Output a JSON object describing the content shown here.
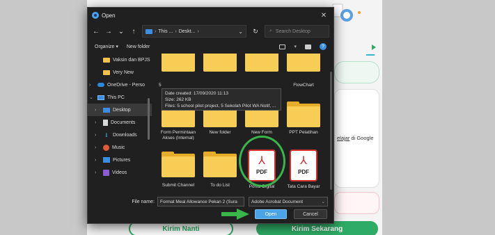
{
  "dialog": {
    "title": "Open",
    "nav": {
      "back": "←",
      "forward": "→",
      "down": "⌄",
      "up": "↑"
    },
    "address": {
      "crumb1": "This ...",
      "crumb2": "Deskt...",
      "sep": "›"
    },
    "search_placeholder": "Search Desktop",
    "toolbar": {
      "organize": "Organize ▾",
      "new_folder": "New folder"
    },
    "sidebar": [
      {
        "label": "Vaksin dan BPJS",
        "icon": "folder-icon"
      },
      {
        "label": "Very New",
        "icon": "folder-icon"
      },
      {
        "label": "OneDrive - Perso",
        "icon": "cloud-icon",
        "arrow": "›"
      },
      {
        "label": "This PC",
        "icon": "pc-icon",
        "arrow": "⌄"
      },
      {
        "label": "Desktop",
        "icon": "desktop-icon",
        "arrow": "›",
        "selected": true
      },
      {
        "label": "Documents",
        "icon": "documents-icon",
        "arrow": "›"
      },
      {
        "label": "Downloads",
        "icon": "downloads-icon",
        "arrow": "›"
      },
      {
        "label": "Music",
        "icon": "music-icon",
        "arrow": "›"
      },
      {
        "label": "Pictures",
        "icon": "pictures-icon",
        "arrow": "›"
      },
      {
        "label": "Videos",
        "icon": "videos-icon",
        "arrow": "›"
      }
    ],
    "tiles": {
      "row1_caption_partial": "5",
      "flowchart": "FlowChart",
      "form_permintaan": "Form Permintaan Akses (Internal)",
      "new_folder_tile": "New folder",
      "new_form": "New Form",
      "ppt_pelatihan": "PPT Pelatihan",
      "submit_channel": "Submit Channel",
      "todo": "To do List",
      "portal_digital": "Portal Digital",
      "tata_cara": "Tata Cara Bayar",
      "pdf_label": "PDF"
    },
    "tooltip": {
      "line1": "Date created: 17/09/2020 11:13",
      "line2": "Size: 262 KB",
      "line3": "Files: 5 school pilot project, 5 Sekolah Pilot WA Notif, ..."
    },
    "file_name_label": "File name:",
    "file_name_value": "Format Meal Allowance Pekan 2 (Sura",
    "file_type": "Adobe Acrobat Document",
    "open_button": "Open",
    "cancel_button": "Cancel",
    "close_glyph": "✕"
  },
  "background": {
    "google_text_pre": "elajar",
    "google_text_post": " di Google",
    "kirim_nanti": "Kirim Nanti",
    "kirim_sekarang": "Kirim Sekarang"
  },
  "colors": {
    "accent_green": "#2eab65",
    "highlight_green": "#3ab54a",
    "pdf_red": "#d3302c",
    "folder_yellow": "#f7cd55"
  }
}
